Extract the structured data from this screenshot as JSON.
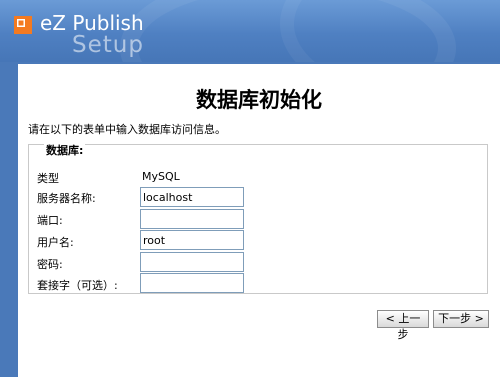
{
  "header": {
    "logo_text": "eZ Publish",
    "logo_sub": "Setup"
  },
  "page": {
    "title": "数据库初始化",
    "intro": "请在以下的表单中输入数据库访问信息。"
  },
  "form": {
    "legend": "数据库:",
    "type_label": "类型",
    "type_value": "MySQL",
    "server_label": "服务器名称:",
    "server_value": "localhost",
    "port_label": "端口:",
    "port_value": "",
    "user_label": "用户名:",
    "user_value": "root",
    "password_label": "密码:",
    "password_value": "",
    "socket_label": "套接字（可选）:",
    "socket_value": ""
  },
  "buttons": {
    "prev": "< 上一步",
    "next": "下一步 >"
  },
  "colors": {
    "header_blue": "#4f80c2",
    "logo_orange": "#f47a20"
  }
}
